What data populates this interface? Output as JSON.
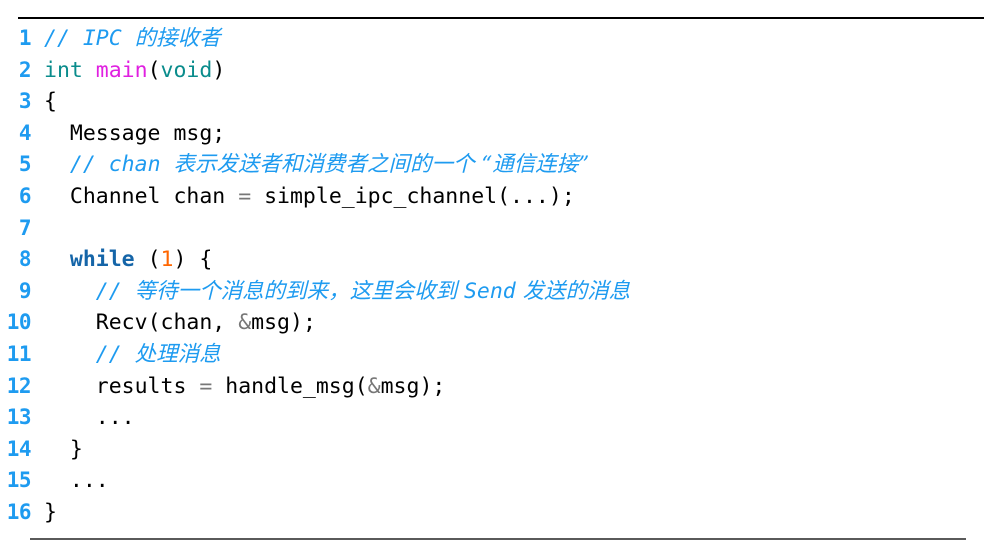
{
  "listing": {
    "language": "c",
    "title_comment": "// IPC 的接收者",
    "colors": {
      "background": "#ffffff",
      "line_number": "#1E9BF0",
      "comment": "#1E9BF0",
      "keyword": "#1565A8",
      "type": "#0A8C8C",
      "function": "#E020E0",
      "number": "#FF6600",
      "operator": "#777777",
      "plain": "#000000",
      "rule_top": "#000000",
      "rule_bottom": "#5a5a5a"
    },
    "lines": [
      {
        "n": "1",
        "text": "// IPC 的接收者"
      },
      {
        "n": "2",
        "text": "int main(void)"
      },
      {
        "n": "3",
        "text": "{"
      },
      {
        "n": "4",
        "text": "  Message msg;"
      },
      {
        "n": "5",
        "text": "  // chan 表示发送者和消费者之间的一个 “通信连接”"
      },
      {
        "n": "6",
        "text": "  Channel chan = simple_ipc_channel(...);"
      },
      {
        "n": "7",
        "text": ""
      },
      {
        "n": "8",
        "text": "  while (1) {"
      },
      {
        "n": "9",
        "text": "    // 等待一个消息的到来，这里会收到 Send 发送的消息"
      },
      {
        "n": "10",
        "text": "    Recv(chan, &msg);"
      },
      {
        "n": "11",
        "text": "    // 处理消息"
      },
      {
        "n": "12",
        "text": "    results = handle_msg(&msg);"
      },
      {
        "n": "13",
        "text": "    ..."
      },
      {
        "n": "14",
        "text": "  }"
      },
      {
        "n": "15",
        "text": "  ..."
      },
      {
        "n": "16",
        "text": "}"
      }
    ],
    "tokens": {
      "l1": {
        "slashes": "// ",
        "ipc": "IPC ",
        "cn": "的接收者"
      },
      "l2": {
        "int": "int",
        "sp1": " ",
        "main": "main",
        "lparen": "(",
        "void": "void",
        "rparen": ")"
      },
      "l3": {
        "brace": "{"
      },
      "l4": {
        "indent": "  ",
        "type": "Message",
        "sp": " ",
        "name": "msg",
        "semi": ";"
      },
      "l5": {
        "indent": "  ",
        "slashes": "// ",
        "chan": "chan",
        "sp": " ",
        "cn": "表示发送者和消费者之间的一个 “通信连接”"
      },
      "l6": {
        "indent": "  ",
        "type": "Channel",
        "sp1": " ",
        "name": "chan",
        "sp2": " ",
        "eq": "=",
        "sp3": " ",
        "call": "simple_ipc_channel",
        "args": "(...)",
        "semi": ";"
      },
      "l7": {
        "empty": ""
      },
      "l8": {
        "indent": "  ",
        "kw": "while",
        "sp": " ",
        "lparen": "(",
        "num": "1",
        "rparen": ")",
        "sp2": " ",
        "brace": "{"
      },
      "l9": {
        "indent": "    ",
        "slashes": "// ",
        "cn1": "等待一个消息的到来，这里会收到 ",
        "send": "Send",
        "cn2": " 发送的消息"
      },
      "l10": {
        "indent": "    ",
        "call": "Recv",
        "lparen": "(",
        "a1": "chan",
        "comma": ", ",
        "amp": "&",
        "a2": "msg",
        "rparen": ")",
        "semi": ";"
      },
      "l11": {
        "indent": "    ",
        "slashes": "// ",
        "cn": "处理消息"
      },
      "l12": {
        "indent": "    ",
        "var": "results",
        "sp1": " ",
        "eq": "=",
        "sp2": " ",
        "call": "handle_msg",
        "lparen": "(",
        "amp": "&",
        "arg": "msg",
        "rparen": ")",
        "semi": ";"
      },
      "l13": {
        "indent": "    ",
        "dots": "..."
      },
      "l14": {
        "indent": "  ",
        "brace": "}"
      },
      "l15": {
        "indent": "  ",
        "dots": "..."
      },
      "l16": {
        "brace": "}"
      }
    }
  }
}
